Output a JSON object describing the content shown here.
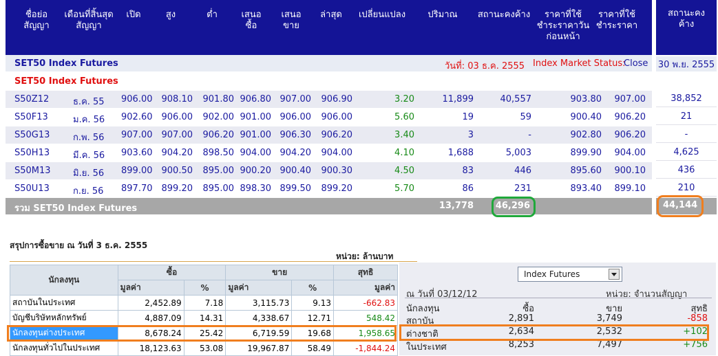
{
  "header_cols": [
    "ชื่อย่อ สัญญา",
    "เดือนที่สิ้นสุดสัญญา",
    "เปิด",
    "สูง",
    "ต่ำ",
    "เสนอ ซื้อ",
    "เสนอ ขาย",
    "ล่าสุด",
    "เปลี่ยนแปลง",
    "ปริมาณ",
    "สถานะคงค้าง",
    "ราคาที่ใช้ชำระราคาวันก่อนหน้า",
    "ราคาที่ใช้ชำระราคา"
  ],
  "right_header": "สถานะคงค้าง",
  "section_title": "SET50 Index Futures",
  "date_label": "วันที่: 03 ธ.ค. 2555",
  "market_status_label": "Index Market Status:",
  "market_status_value": "Close",
  "right_date": "30 พ.ย. 2555",
  "subtitle": "SET50 Index Futures",
  "rows": [
    {
      "sym": "S50Z12",
      "month": "ธ.ค. 55",
      "open": "906.00",
      "high": "908.10",
      "low": "901.80",
      "bid": "906.80",
      "offer": "907.00",
      "last": "906.90",
      "chg": "3.20",
      "vol": "11,899",
      "oi": "40,557",
      "prev": "903.80",
      "settle": "907.00",
      "oi_prev": "38,852"
    },
    {
      "sym": "S50F13",
      "month": "ม.ค. 56",
      "open": "902.60",
      "high": "906.00",
      "low": "902.00",
      "bid": "901.00",
      "offer": "906.00",
      "last": "906.00",
      "chg": "5.60",
      "vol": "19",
      "oi": "59",
      "prev": "900.40",
      "settle": "906.20",
      "oi_prev": "21"
    },
    {
      "sym": "S50G13",
      "month": "ก.พ. 56",
      "open": "907.00",
      "high": "907.00",
      "low": "906.20",
      "bid": "901.00",
      "offer": "906.30",
      "last": "906.20",
      "chg": "3.40",
      "vol": "3",
      "oi": "-",
      "prev": "902.80",
      "settle": "906.20",
      "oi_prev": "-"
    },
    {
      "sym": "S50H13",
      "month": "มี.ค. 56",
      "open": "903.60",
      "high": "904.20",
      "low": "898.50",
      "bid": "904.00",
      "offer": "904.20",
      "last": "904.00",
      "chg": "4.10",
      "vol": "1,688",
      "oi": "5,003",
      "prev": "899.90",
      "settle": "904.00",
      "oi_prev": "4,625"
    },
    {
      "sym": "S50M13",
      "month": "มิ.ย. 56",
      "open": "899.00",
      "high": "900.50",
      "low": "895.00",
      "bid": "900.20",
      "offer": "900.40",
      "last": "900.30",
      "chg": "4.50",
      "vol": "83",
      "oi": "446",
      "prev": "895.60",
      "settle": "900.10",
      "oi_prev": "436"
    },
    {
      "sym": "S50U13",
      "month": "ก.ย. 56",
      "open": "897.70",
      "high": "899.20",
      "low": "895.00",
      "bid": "898.30",
      "offer": "899.50",
      "last": "899.20",
      "chg": "5.70",
      "vol": "86",
      "oi": "231",
      "prev": "893.40",
      "settle": "899.10",
      "oi_prev": "210"
    }
  ],
  "total": {
    "label": "รวม SET50 Index Futures",
    "vol": "13,778",
    "oi": "46,296",
    "oi_prev": "44,144"
  },
  "summary": {
    "title": "สรุปการซื้อขาย ณ วันที่ 3 ธ.ค. 2555",
    "unit": "หน่วย: ล้านบาท",
    "h_investor": "นักลงทุน",
    "h_buy": "ซื้อ",
    "h_sell": "ขาย",
    "h_net": "สุทธิ",
    "h_value": "มูลค่า",
    "h_pct": "%",
    "rows": [
      {
        "name": "สถาบันในประเทศ",
        "bv": "2,452.89",
        "bp": "7.18",
        "sv": "3,115.73",
        "sp": "9.13",
        "net": "-662.83",
        "neg": true
      },
      {
        "name": "บัญชีบริษัทหลักทรัพย์",
        "bv": "4,887.09",
        "bp": "14.31",
        "sv": "4,338.67",
        "sp": "12.71",
        "net": "548.42",
        "neg": false
      },
      {
        "name": "นักลงทุนต่างประเทศ",
        "bv": "8,678.24",
        "bp": "25.42",
        "sv": "6,719.59",
        "sp": "19.68",
        "net": "1,958.65",
        "neg": false
      },
      {
        "name": "นักลงทุนทั่วไปในประเทศ",
        "bv": "18,123.63",
        "bp": "53.08",
        "sv": "19,967.87",
        "sp": "58.49",
        "net": "-1,844.24",
        "neg": true
      }
    ]
  },
  "right_panel": {
    "select_value": "Index Futures",
    "date": "ณ วันที่ 03/12/12",
    "unit": "หน่วย: จำนวนสัญญา",
    "h_investor": "นักลงทุน",
    "h_buy": "ซื้อ",
    "h_sell": "ขาย",
    "h_net": "สุทธิ",
    "rows": [
      {
        "name": "สถาบัน",
        "buy": "2,891",
        "sell": "3,749",
        "net": "-858",
        "neg": true
      },
      {
        "name": "ต่างชาติ",
        "buy": "2,634",
        "sell": "2,532",
        "net": "+102",
        "neg": false
      },
      {
        "name": "ในประเทศ",
        "buy": "8,253",
        "sell": "7,497",
        "net": "+756",
        "neg": false
      }
    ]
  },
  "colors": {
    "header_bg": "#141496",
    "highlight_green": "#1fa83a",
    "highlight_orange": "#f07e1e"
  }
}
